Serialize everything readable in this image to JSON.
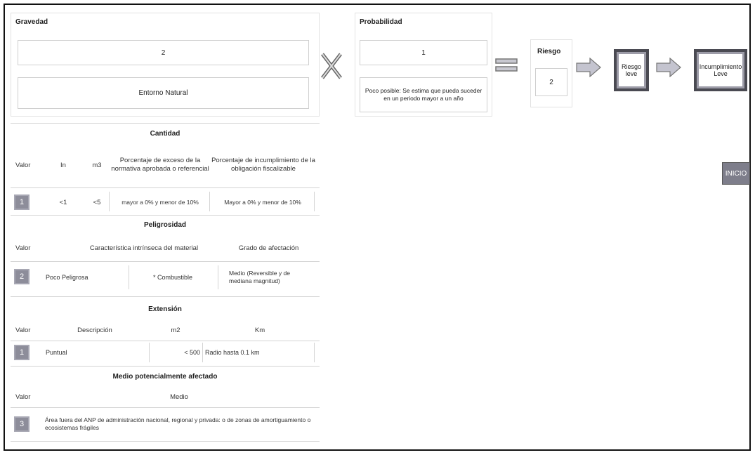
{
  "gravedad": {
    "title": "Gravedad",
    "value": "2",
    "category": "Entorno Natural"
  },
  "operator_x": "X",
  "probabilidad": {
    "title": "Probabilidad",
    "value": "1",
    "description": "Poco posible: Se estima que pueda suceder en un periodo mayor a un año"
  },
  "riesgo": {
    "title": "Riesgo",
    "value": "2"
  },
  "result_box_1": "Riesgo leve",
  "result_box_2": "Incumplimiento Leve",
  "inicio_button": "INICIO",
  "cantidad": {
    "title": "Cantidad",
    "headers": [
      "Valor",
      "In",
      "m3",
      "Porcentaje de exceso de la normativa aprobada o referencial",
      "Porcentaje de incumplimiento de la obligación fiscalizable"
    ],
    "row": {
      "badge": "1",
      "tn": "<1",
      "m3": "<5",
      "exceso": "mayor a 0% y menor de 10%",
      "incumplimiento": "Mayor a 0% y menor de 10%"
    }
  },
  "peligrosidad": {
    "title": "Peligrosidad",
    "headers": [
      "Valor",
      "Característica intrínseca del material",
      "Grado de afectación"
    ],
    "row": {
      "badge": "2",
      "col1": "Poco Peligrosa",
      "col2": "* Combustible",
      "col3": "Medio (Reversible y de mediana magnitud)"
    }
  },
  "extension": {
    "title": "Extensión",
    "headers": [
      "Valor",
      "Descripción",
      "m2",
      "Km"
    ],
    "row": {
      "badge": "1",
      "desc": "Puntual",
      "m2": "< 500",
      "km": "Radio hasta 0.1 km"
    }
  },
  "medio": {
    "title": "Medio potencialmente afectado",
    "headers": [
      "Valor",
      "Medio"
    ],
    "row": {
      "badge": "3",
      "text": "Área fuera del ANP de administración nacional, regional y privada: o de zonas de amortiguamiento o ecosistemas frágiles"
    }
  },
  "colors": {
    "badge": "#8d8d9a",
    "dark_border": "#4a4a52",
    "arrow": "#b9b9c4"
  }
}
